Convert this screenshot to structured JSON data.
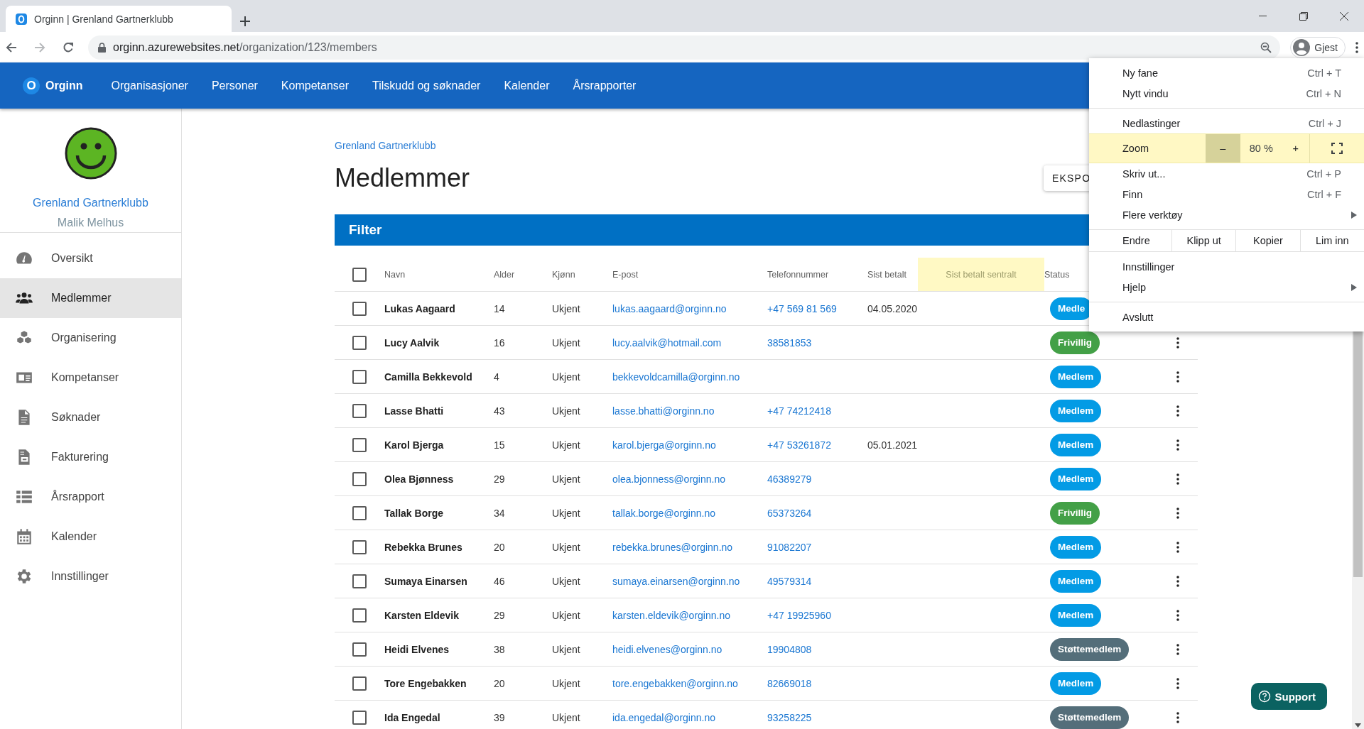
{
  "browser": {
    "tab_title": "Orginn | Grenland Gartnerklubb",
    "url_domain": "orginn.azurewebsites.net",
    "url_path": "/organization/123/members",
    "profile_label": "Gjest"
  },
  "app_nav": {
    "logo_letter": "O",
    "brand": "Orginn",
    "items": [
      "Organisasjoner",
      "Personer",
      "Kompetanser",
      "Tilskudd og søknader",
      "Kalender",
      "Årsrapporter"
    ]
  },
  "sidebar": {
    "org_name": "Grenland Gartnerklubb",
    "user_name": "Malik Melhus",
    "items": [
      {
        "label": "Oversikt",
        "selected": false
      },
      {
        "label": "Medlemmer",
        "selected": true
      },
      {
        "label": "Organisering",
        "selected": false
      },
      {
        "label": "Kompetanser",
        "selected": false
      },
      {
        "label": "Søknader",
        "selected": false
      },
      {
        "label": "Fakturering",
        "selected": false
      },
      {
        "label": "Årsrapport",
        "selected": false
      },
      {
        "label": "Kalender",
        "selected": false
      },
      {
        "label": "Innstillinger",
        "selected": false
      }
    ]
  },
  "page": {
    "breadcrumb": "Grenland Gartnerklubb",
    "title": "Medlemmer",
    "export_button": "EKSPO",
    "filter_label": "Filter"
  },
  "table": {
    "all_selected": false,
    "columns": [
      {
        "label": "Navn",
        "highlighted": false
      },
      {
        "label": "Alder",
        "highlighted": false
      },
      {
        "label": "Kjønn",
        "highlighted": false
      },
      {
        "label": "E-post",
        "highlighted": false
      },
      {
        "label": "Telefonnummer",
        "highlighted": false
      },
      {
        "label": "Sist betalt",
        "highlighted": false
      },
      {
        "label": "Sist betalt sentralt",
        "highlighted": true
      },
      {
        "label": "Status",
        "highlighted": false
      }
    ],
    "rows": [
      {
        "selected": false,
        "name": "Lukas Aagaard",
        "age": "14",
        "gender": "Ukjent",
        "email": "lukas.aagaard@orginn.no",
        "phone": "+47 569 81 569",
        "last_paid": "04.05.2020",
        "status": {
          "label": "Medle",
          "color": "#039be5"
        }
      },
      {
        "selected": false,
        "name": "Lucy Aalvik",
        "age": "16",
        "gender": "Ukjent",
        "email": "lucy.aalvik@hotmail.com",
        "phone": "38581853",
        "status": {
          "label": "Frivillig",
          "color": "#43a047"
        }
      },
      {
        "selected": false,
        "name": "Camilla Bekkevold",
        "age": "4",
        "gender": "Ukjent",
        "email": "bekkevoldcamilla@orginn.no",
        "status": {
          "label": "Medlem",
          "color": "#039be5"
        }
      },
      {
        "selected": false,
        "name": "Lasse Bhatti",
        "age": "43",
        "gender": "Ukjent",
        "email": "lasse.bhatti@orginn.no",
        "phone": "+47 74212418",
        "status": {
          "label": "Medlem",
          "color": "#039be5"
        }
      },
      {
        "selected": false,
        "name": "Karol Bjerga",
        "age": "15",
        "gender": "Ukjent",
        "email": "karol.bjerga@orginn.no",
        "phone": "+47 53261872",
        "last_paid": "05.01.2021",
        "status": {
          "label": "Medlem",
          "color": "#039be5"
        }
      },
      {
        "selected": false,
        "name": "Olea Bjønness",
        "age": "29",
        "gender": "Ukjent",
        "email": "olea.bjonness@orginn.no",
        "phone": "46389279",
        "status": {
          "label": "Medlem",
          "color": "#039be5"
        }
      },
      {
        "selected": false,
        "name": "Tallak Borge",
        "age": "34",
        "gender": "Ukjent",
        "email": "tallak.borge@orginn.no",
        "phone": "65373264",
        "status": {
          "label": "Frivillig",
          "color": "#43a047"
        }
      },
      {
        "selected": false,
        "name": "Rebekka Brunes",
        "age": "20",
        "gender": "Ukjent",
        "email": "rebekka.brunes@orginn.no",
        "phone": "91082207",
        "status": {
          "label": "Medlem",
          "color": "#039be5"
        }
      },
      {
        "selected": false,
        "name": "Sumaya Einarsen",
        "age": "46",
        "gender": "Ukjent",
        "email": "sumaya.einarsen@orginn.no",
        "phone": "49579314",
        "status": {
          "label": "Medlem",
          "color": "#039be5"
        }
      },
      {
        "selected": false,
        "name": "Karsten Eldevik",
        "age": "29",
        "gender": "Ukjent",
        "email": "karsten.eldevik@orginn.no",
        "phone": "+47 19925960",
        "status": {
          "label": "Medlem",
          "color": "#039be5"
        }
      },
      {
        "selected": false,
        "name": "Heidi Elvenes",
        "age": "38",
        "gender": "Ukjent",
        "email": "heidi.elvenes@orginn.no",
        "phone": "19904808",
        "status": {
          "label": "Støttemedlem",
          "color": "#546e7a"
        }
      },
      {
        "selected": false,
        "name": "Tore Engebakken",
        "age": "20",
        "gender": "Ukjent",
        "email": "tore.engebakken@orginn.no",
        "phone": "82669018",
        "status": {
          "label": "Medlem",
          "color": "#039be5"
        }
      },
      {
        "selected": false,
        "name": "Ida Engedal",
        "age": "39",
        "gender": "Ukjent",
        "email": "ida.engedal@orginn.no",
        "phone": "93258225",
        "status": {
          "label": "Støttemedlem",
          "color": "#546e7a"
        }
      }
    ]
  },
  "menu": {
    "groups": [
      [
        {
          "kind": "item",
          "label": "Ny fane",
          "shortcut": "Ctrl + T"
        },
        {
          "kind": "item",
          "label": "Nytt vindu",
          "shortcut": "Ctrl + N"
        }
      ],
      [
        {
          "kind": "item",
          "label": "Nedlastinger",
          "shortcut": "Ctrl + J"
        },
        {
          "kind": "zoom",
          "label": "Zoom",
          "minus": "–",
          "value": "80 %",
          "plus": "+",
          "highlighted": true
        },
        {
          "kind": "item",
          "label": "Skriv ut...",
          "shortcut": "Ctrl + P"
        },
        {
          "kind": "item",
          "label": "Finn",
          "shortcut": "Ctrl + F"
        },
        {
          "kind": "submenu",
          "label": "Flere verktøy"
        }
      ],
      [
        {
          "kind": "edit",
          "label": "Endre",
          "actions": [
            "Klipp ut",
            "Kopier",
            "Lim inn"
          ]
        }
      ],
      [
        {
          "kind": "item",
          "label": "Innstillinger"
        },
        {
          "kind": "submenu",
          "label": "Hjelp"
        }
      ],
      [
        {
          "kind": "item",
          "label": "Avslutt"
        }
      ]
    ]
  },
  "support_button": "Support"
}
